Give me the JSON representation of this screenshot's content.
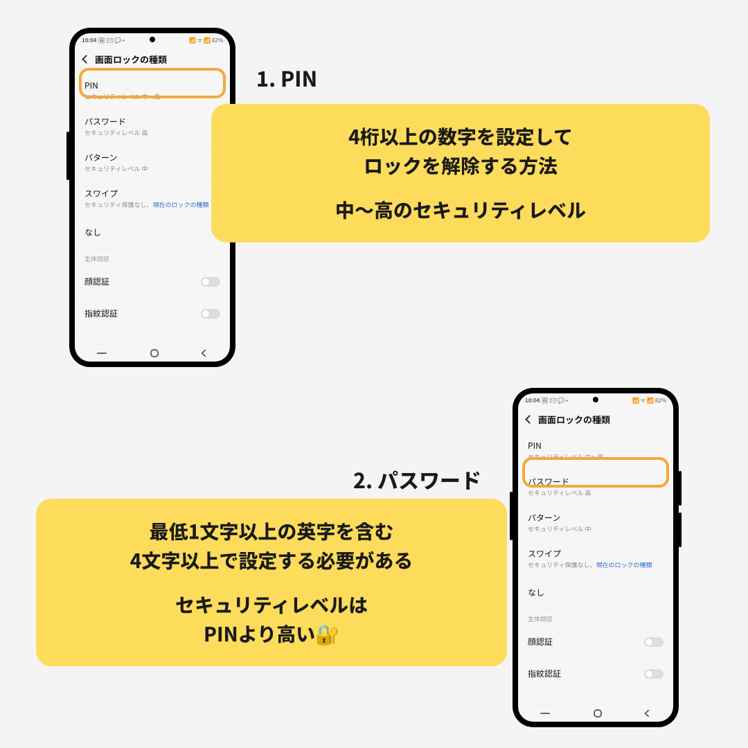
{
  "statusbar": {
    "time": "10:04",
    "left_icons": "🖼 ✉ 💬 •",
    "right_icons": "📶 ᯤ 📶 82%",
    "battery_pct": "82%"
  },
  "header": {
    "title": "画面ロックの種類"
  },
  "lock_options": [
    {
      "title": "PIN",
      "sub_a": "セキュリティレベル 中〜高",
      "sub_b": ""
    },
    {
      "title": "パスワード",
      "sub_a": "セキュリティレベル 高",
      "sub_b": ""
    },
    {
      "title": "パターン",
      "sub_a": "セキュリティレベル 中",
      "sub_b": ""
    },
    {
      "title": "スワイプ",
      "sub_a": "セキュリティ保護なし、",
      "sub_b": "現在のロックの種類"
    },
    {
      "title": "なし",
      "sub_a": "",
      "sub_b": ""
    }
  ],
  "biometrics_header": "生体認証",
  "biometrics": [
    {
      "title": "顔認証"
    },
    {
      "title": "指紋認証"
    }
  ],
  "section1": {
    "title": "1. PIN",
    "line1": "4桁以上の数字を設定して",
    "line2": "ロックを解除する方法",
    "line3": "中〜高のセキュリティレベル"
  },
  "section2": {
    "title": "2. パスワード",
    "line1": "最低1文字以上の英字を含む",
    "line2": "4文字以上で設定する必要がある",
    "line3": "セキュリティレベルは",
    "line4": "PINより高い🔐"
  }
}
